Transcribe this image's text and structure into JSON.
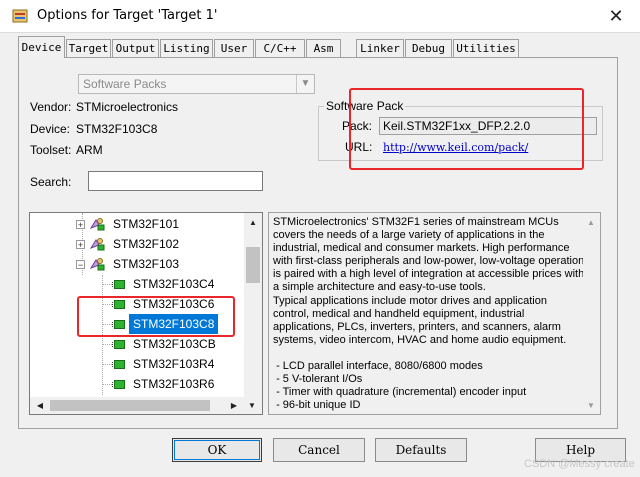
{
  "window": {
    "title": "Options for Target 'Target 1'",
    "close_glyph": "✕"
  },
  "tabs": [
    {
      "label": "Device",
      "active": true
    },
    {
      "label": "Target"
    },
    {
      "label": "Output"
    },
    {
      "label": "Listing"
    },
    {
      "label": "User"
    },
    {
      "label": "C/C++"
    },
    {
      "label": "Asm"
    },
    {
      "label": "Linker"
    },
    {
      "label": "Debug"
    },
    {
      "label": "Utilities"
    }
  ],
  "device": {
    "database_select": "Software Packs",
    "vendor_label": "Vendor:",
    "vendor_value": "STMicroelectronics",
    "device_label": "Device:",
    "device_value": "STM32F103C8",
    "toolset_label": "Toolset:",
    "toolset_value": "ARM",
    "search_label": "Search:",
    "search_value": ""
  },
  "software_pack": {
    "legend": "Software Pack",
    "pack_label": "Pack:",
    "pack_value": "Keil.STM32F1xx_DFP.2.2.0",
    "url_label": "URL:",
    "url_value": "http://www.keil.com/pack/"
  },
  "tree": {
    "families": [
      "STM32F101",
      "STM32F102",
      "STM32F103"
    ],
    "devices": [
      "STM32F103C4",
      "STM32F103C6",
      "STM32F103C8",
      "STM32F103CB",
      "STM32F103R4",
      "STM32F103R6"
    ],
    "selected": "STM32F103C8"
  },
  "description": "STMicroelectronics' STM32F1 series of mainstream MCUs covers the needs of a large variety of applications in the industrial, medical and consumer markets. High performance with first-class peripherals and low-power, low-voltage operation is paired with a high level of integration at accessible prices with a simple architecture and easy-to-use tools.\nTypical applications include motor drives and application control, medical and handheld equipment, industrial applications, PLCs, inverters, printers, and scanners, alarm systems, video intercom, HVAC and home audio equipment.\n\n - LCD parallel interface, 8080/6800 modes\n - 5 V-tolerant I/Os\n - Timer with quadrature (incremental) encoder input\n - 96-bit unique ID",
  "buttons": {
    "ok": "OK",
    "cancel": "Cancel",
    "defaults": "Defaults",
    "help": "Help"
  },
  "watermark": "CSDN @Messy create",
  "colors": {
    "highlight": "#e8262c",
    "selection": "#0078d7",
    "link": "#0000cc"
  },
  "icons": {
    "app": "keil-target-icon",
    "family": "device-family-icon",
    "chip": "chip-icon"
  }
}
